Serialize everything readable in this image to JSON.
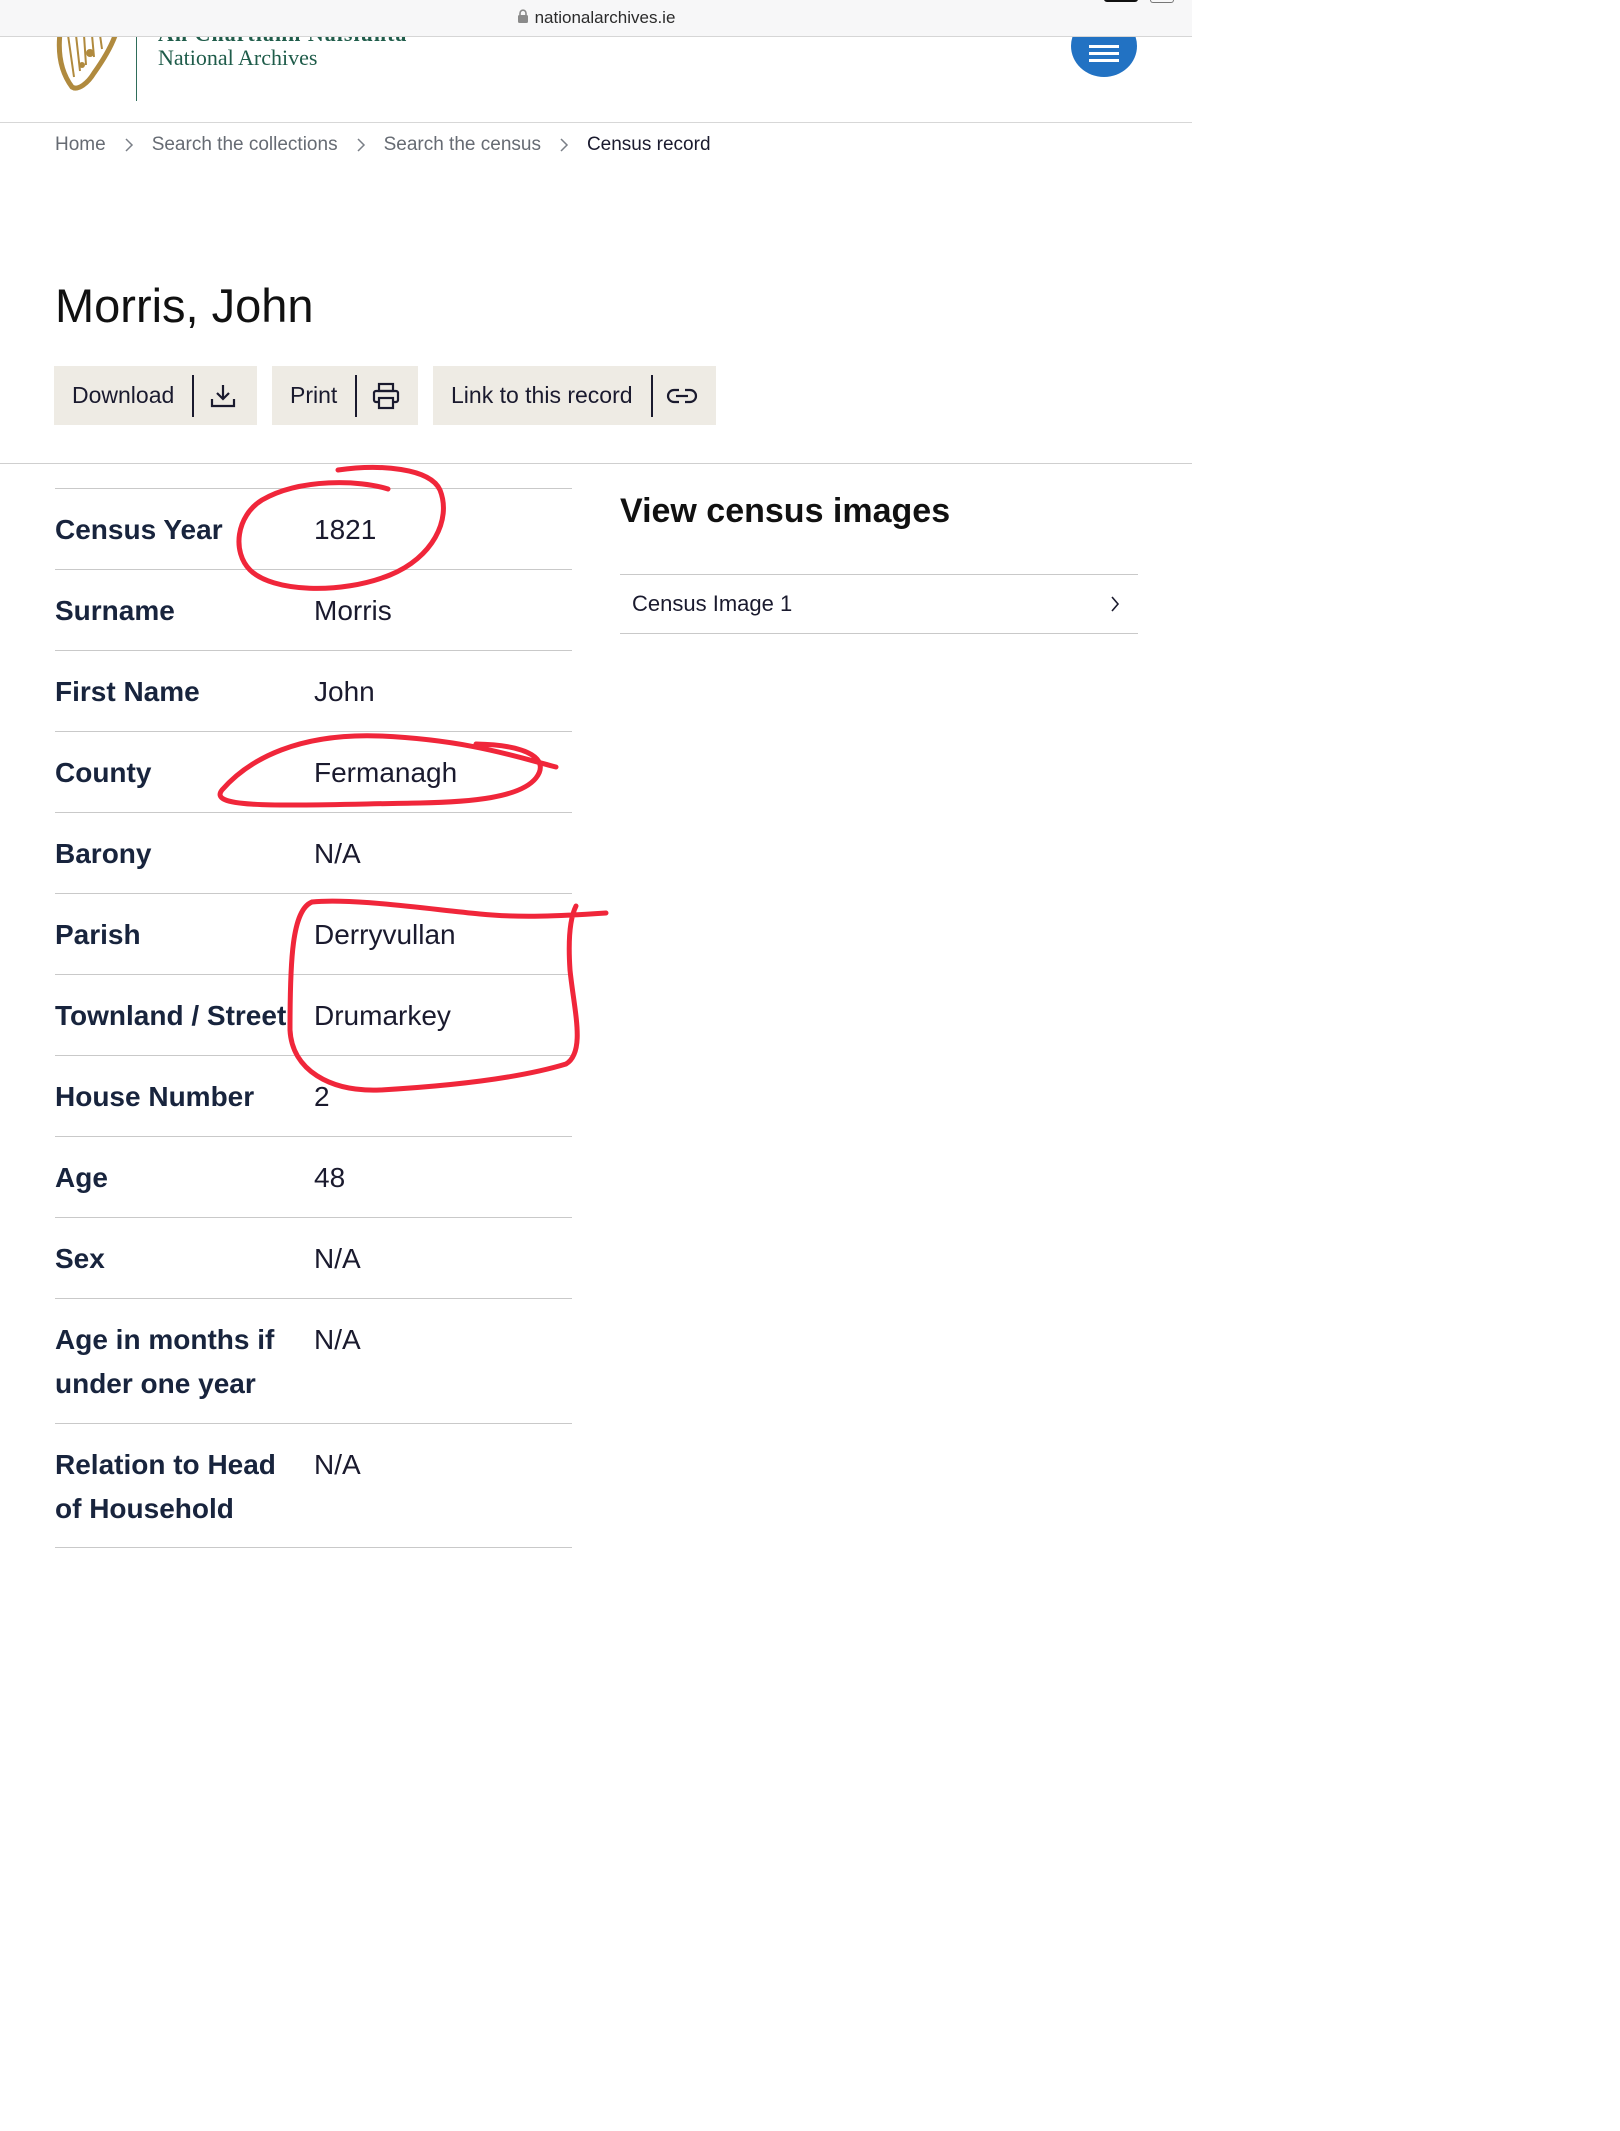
{
  "browser": {
    "url": "nationalarchives.ie"
  },
  "logo": {
    "irish_name": "An Chartlann Náisiúnta",
    "english_name": "National Archives"
  },
  "breadcrumb": {
    "home": "Home",
    "collections": "Search the collections",
    "census": "Search the census",
    "current": "Census record"
  },
  "record": {
    "title": "Morris, John",
    "fields": [
      {
        "label": "Census Year",
        "value": "1821"
      },
      {
        "label": "Surname",
        "value": "Morris"
      },
      {
        "label": "First Name",
        "value": "John"
      },
      {
        "label": "County",
        "value": "Fermanagh"
      },
      {
        "label": "Barony",
        "value": "N/A"
      },
      {
        "label": "Parish",
        "value": "Derryvullan"
      },
      {
        "label": "Townland / Street",
        "value": "Drumarkey"
      },
      {
        "label": "House Number",
        "value": "2"
      },
      {
        "label": "Age",
        "value": "48"
      },
      {
        "label": "Sex",
        "value": "N/A"
      },
      {
        "label": "Age in months if under one year",
        "value": "N/A"
      },
      {
        "label": "Relation to Head of Household",
        "value": "N/A"
      }
    ]
  },
  "actions": {
    "download": "Download",
    "print": "Print",
    "link": "Link to this record"
  },
  "images": {
    "heading": "View census images",
    "items": [
      {
        "label": "Census Image 1"
      }
    ]
  },
  "colors": {
    "accent_blue": "#2272c3",
    "button_bg": "#eeebe4",
    "annotation_red": "#f0263a",
    "logo_green": "#1f5c4a",
    "harp_gold": "#b08a3e"
  },
  "icons": {
    "lock": "lock-icon",
    "menu": "hamburger-icon",
    "breadcrumb_sep": "chevron-right-icon",
    "download": "download-icon",
    "print": "printer-icon",
    "link": "link-icon",
    "image_item": "chevron-right-icon"
  }
}
